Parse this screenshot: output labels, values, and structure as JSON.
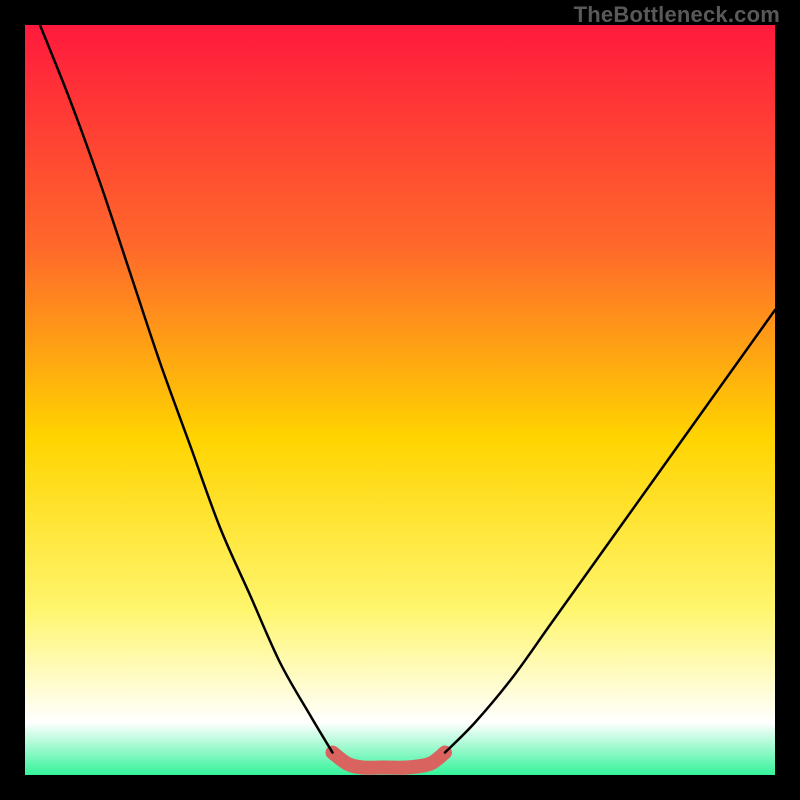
{
  "watermark": "TheBottleneck.com",
  "colors": {
    "frame": "#000000",
    "gradient_top": "#ff1a3d",
    "gradient_mid_upper": "#ff6a2a",
    "gradient_mid": "#ffd400",
    "gradient_mid_lower": "#fff66e",
    "gradient_lower": "#ffffff",
    "gradient_bottom": "#34f39a",
    "curve": "#000000",
    "sweet_spot": "#d9635f"
  },
  "chart_data": {
    "type": "line",
    "title": "",
    "xlabel": "",
    "ylabel": "",
    "x_range": [
      0,
      100
    ],
    "y_range": [
      0,
      100
    ],
    "series": [
      {
        "name": "bottleneck-curve-left",
        "x": [
          2,
          6,
          10,
          14,
          18,
          22,
          26,
          30,
          34,
          38,
          41
        ],
        "values": [
          100,
          90,
          79,
          67,
          55,
          44,
          33,
          24,
          15,
          8,
          3
        ]
      },
      {
        "name": "bottleneck-curve-right",
        "x": [
          56,
          60,
          65,
          70,
          75,
          80,
          85,
          90,
          95,
          100
        ],
        "values": [
          3,
          7,
          13,
          20,
          27,
          34,
          41,
          48,
          55,
          62
        ]
      },
      {
        "name": "sweet-spot-band",
        "x": [
          41,
          43,
          45,
          48,
          51,
          54,
          56
        ],
        "values": [
          3,
          1.5,
          1,
          1,
          1,
          1.5,
          3
        ]
      }
    ],
    "annotations": []
  }
}
